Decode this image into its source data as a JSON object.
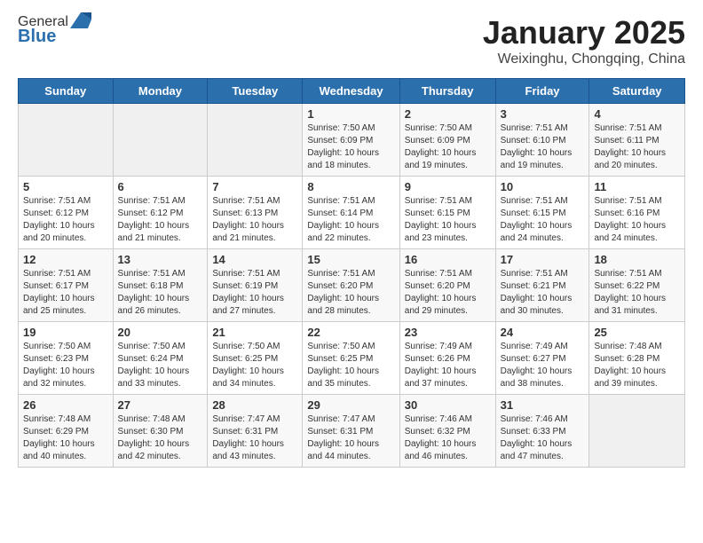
{
  "header": {
    "logo_general": "General",
    "logo_blue": "Blue",
    "month_title": "January 2025",
    "location": "Weixinghu, Chongqing, China"
  },
  "weekdays": [
    "Sunday",
    "Monday",
    "Tuesday",
    "Wednesday",
    "Thursday",
    "Friday",
    "Saturday"
  ],
  "weeks": [
    [
      {
        "day": "",
        "info": ""
      },
      {
        "day": "",
        "info": ""
      },
      {
        "day": "",
        "info": ""
      },
      {
        "day": "1",
        "info": "Sunrise: 7:50 AM\nSunset: 6:09 PM\nDaylight: 10 hours\nand 18 minutes."
      },
      {
        "day": "2",
        "info": "Sunrise: 7:50 AM\nSunset: 6:09 PM\nDaylight: 10 hours\nand 19 minutes."
      },
      {
        "day": "3",
        "info": "Sunrise: 7:51 AM\nSunset: 6:10 PM\nDaylight: 10 hours\nand 19 minutes."
      },
      {
        "day": "4",
        "info": "Sunrise: 7:51 AM\nSunset: 6:11 PM\nDaylight: 10 hours\nand 20 minutes."
      }
    ],
    [
      {
        "day": "5",
        "info": "Sunrise: 7:51 AM\nSunset: 6:12 PM\nDaylight: 10 hours\nand 20 minutes."
      },
      {
        "day": "6",
        "info": "Sunrise: 7:51 AM\nSunset: 6:12 PM\nDaylight: 10 hours\nand 21 minutes."
      },
      {
        "day": "7",
        "info": "Sunrise: 7:51 AM\nSunset: 6:13 PM\nDaylight: 10 hours\nand 21 minutes."
      },
      {
        "day": "8",
        "info": "Sunrise: 7:51 AM\nSunset: 6:14 PM\nDaylight: 10 hours\nand 22 minutes."
      },
      {
        "day": "9",
        "info": "Sunrise: 7:51 AM\nSunset: 6:15 PM\nDaylight: 10 hours\nand 23 minutes."
      },
      {
        "day": "10",
        "info": "Sunrise: 7:51 AM\nSunset: 6:15 PM\nDaylight: 10 hours\nand 24 minutes."
      },
      {
        "day": "11",
        "info": "Sunrise: 7:51 AM\nSunset: 6:16 PM\nDaylight: 10 hours\nand 24 minutes."
      }
    ],
    [
      {
        "day": "12",
        "info": "Sunrise: 7:51 AM\nSunset: 6:17 PM\nDaylight: 10 hours\nand 25 minutes."
      },
      {
        "day": "13",
        "info": "Sunrise: 7:51 AM\nSunset: 6:18 PM\nDaylight: 10 hours\nand 26 minutes."
      },
      {
        "day": "14",
        "info": "Sunrise: 7:51 AM\nSunset: 6:19 PM\nDaylight: 10 hours\nand 27 minutes."
      },
      {
        "day": "15",
        "info": "Sunrise: 7:51 AM\nSunset: 6:20 PM\nDaylight: 10 hours\nand 28 minutes."
      },
      {
        "day": "16",
        "info": "Sunrise: 7:51 AM\nSunset: 6:20 PM\nDaylight: 10 hours\nand 29 minutes."
      },
      {
        "day": "17",
        "info": "Sunrise: 7:51 AM\nSunset: 6:21 PM\nDaylight: 10 hours\nand 30 minutes."
      },
      {
        "day": "18",
        "info": "Sunrise: 7:51 AM\nSunset: 6:22 PM\nDaylight: 10 hours\nand 31 minutes."
      }
    ],
    [
      {
        "day": "19",
        "info": "Sunrise: 7:50 AM\nSunset: 6:23 PM\nDaylight: 10 hours\nand 32 minutes."
      },
      {
        "day": "20",
        "info": "Sunrise: 7:50 AM\nSunset: 6:24 PM\nDaylight: 10 hours\nand 33 minutes."
      },
      {
        "day": "21",
        "info": "Sunrise: 7:50 AM\nSunset: 6:25 PM\nDaylight: 10 hours\nand 34 minutes."
      },
      {
        "day": "22",
        "info": "Sunrise: 7:50 AM\nSunset: 6:25 PM\nDaylight: 10 hours\nand 35 minutes."
      },
      {
        "day": "23",
        "info": "Sunrise: 7:49 AM\nSunset: 6:26 PM\nDaylight: 10 hours\nand 37 minutes."
      },
      {
        "day": "24",
        "info": "Sunrise: 7:49 AM\nSunset: 6:27 PM\nDaylight: 10 hours\nand 38 minutes."
      },
      {
        "day": "25",
        "info": "Sunrise: 7:48 AM\nSunset: 6:28 PM\nDaylight: 10 hours\nand 39 minutes."
      }
    ],
    [
      {
        "day": "26",
        "info": "Sunrise: 7:48 AM\nSunset: 6:29 PM\nDaylight: 10 hours\nand 40 minutes."
      },
      {
        "day": "27",
        "info": "Sunrise: 7:48 AM\nSunset: 6:30 PM\nDaylight: 10 hours\nand 42 minutes."
      },
      {
        "day": "28",
        "info": "Sunrise: 7:47 AM\nSunset: 6:31 PM\nDaylight: 10 hours\nand 43 minutes."
      },
      {
        "day": "29",
        "info": "Sunrise: 7:47 AM\nSunset: 6:31 PM\nDaylight: 10 hours\nand 44 minutes."
      },
      {
        "day": "30",
        "info": "Sunrise: 7:46 AM\nSunset: 6:32 PM\nDaylight: 10 hours\nand 46 minutes."
      },
      {
        "day": "31",
        "info": "Sunrise: 7:46 AM\nSunset: 6:33 PM\nDaylight: 10 hours\nand 47 minutes."
      },
      {
        "day": "",
        "info": ""
      }
    ]
  ]
}
